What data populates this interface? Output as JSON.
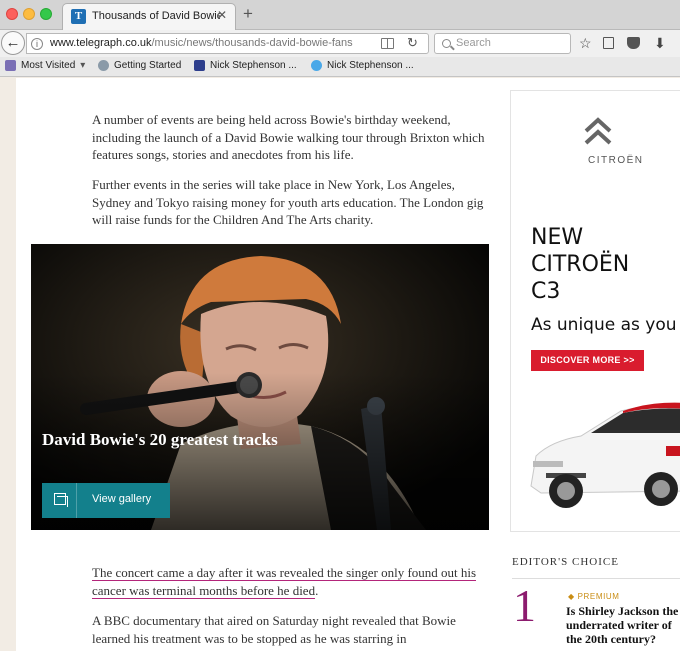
{
  "browser": {
    "tab": {
      "title": "Thousands of David Bowie fans",
      "favicon": "telegraph-favicon"
    },
    "url": {
      "host": "www.telegraph.co.uk",
      "path": "/music/news/thousands-david-bowie-fans"
    },
    "search_placeholder": "Search",
    "bookmarks": [
      {
        "label": "Most Visited",
        "icon": "folder-icon",
        "dropdown": "▾"
      },
      {
        "label": "Getting Started",
        "icon": "firefox-icon"
      },
      {
        "label": "Nick Stephenson ...",
        "icon": "grid-favicon"
      },
      {
        "label": "Nick Stephenson ...",
        "icon": "twitter-icon"
      }
    ]
  },
  "article": {
    "para1": "A number of events are being held across Bowie's birthday weekend, including the launch of a David Bowie walking tour through Brixton which features songs, stories and anecdotes from his life.",
    "para2": "Further events in the series will take place in New York, Los Angeles, Sydney and Tokyo raising money for youth arts education. The London gig will raise funds for the Children And The Arts charity.",
    "gallery": {
      "title": "David Bowie's 20 greatest tracks",
      "button": "View gallery"
    },
    "para3": "The concert came a day after it was revealed the singer only found out his cancer was terminal months before he died",
    "para3_end": ".",
    "para4": "A BBC documentary that aired on Saturday night revealed that Bowie learned his treatment was to be stopped as he was starring in"
  },
  "ad": {
    "brand": "CITROËN",
    "headline": [
      "NEW",
      "CITROËN",
      "C3"
    ],
    "tagline": "As unique as you",
    "cta": "DISCOVER MORE  >>",
    "accent_color": "#d91c2e"
  },
  "editors_choice": {
    "heading": "EDITOR'S CHOICE",
    "item": {
      "number": "1",
      "tag": "PREMIUM",
      "tag_marker": "◆",
      "headline": "Is Shirley Jackson the underrated writer of the 20th century?"
    }
  },
  "colors": {
    "link_underline": "#b3257a",
    "gallery_button": "#13808c",
    "editor_number": "#8c1b6e"
  }
}
